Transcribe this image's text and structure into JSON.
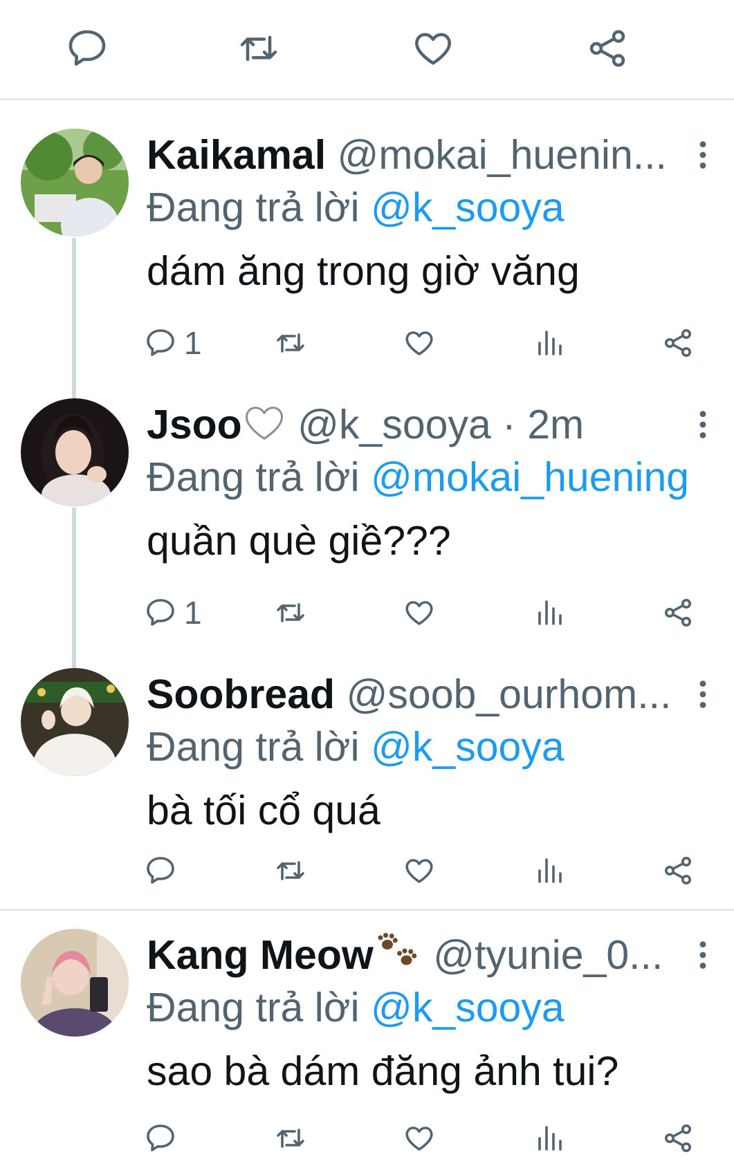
{
  "top_actions": {
    "reply_icon": "comment-icon",
    "retweet_icon": "retweet-icon",
    "like_icon": "heart-icon",
    "share_icon": "share-icon"
  },
  "colors": {
    "text": "#0f1419",
    "secondary": "#536471",
    "mention": "#1d9bf0",
    "divider": "#e6e9eb",
    "thread_line": "#cfd9de"
  },
  "replies": [
    {
      "name": "Kaikamal",
      "name_emoji": "",
      "handle": "@mokai_huenin...",
      "time": "",
      "replying_prefix": "Đang trả lời",
      "replying_to": "@k_sooya",
      "text": "dám ăng trong giờ văng",
      "reply_count": "1",
      "retweet_count": "",
      "like_count": ""
    },
    {
      "name": "Jsoo",
      "name_emoji": "🤍",
      "handle": "@k_sooya · 2m",
      "time": "",
      "replying_prefix": "Đang trả lời",
      "replying_to": "@mokai_huening",
      "text": "quần què giề???",
      "reply_count": "1",
      "retweet_count": "",
      "like_count": ""
    },
    {
      "name": "Soobread",
      "name_emoji": "",
      "handle": "@soob_ourhom...",
      "time": "",
      "replying_prefix": "Đang trả lời",
      "replying_to": "@k_sooya",
      "text": "bà tối cổ quá",
      "reply_count": "",
      "retweet_count": "",
      "like_count": ""
    },
    {
      "name": "Kang Meow",
      "name_emoji": "🐾",
      "handle": "@tyunie_0...",
      "time": "",
      "replying_prefix": "Đang trả lời",
      "replying_to": "@k_sooya",
      "text": "sao bà dám đăng ảnh tui?",
      "reply_count": "",
      "retweet_count": "",
      "like_count": ""
    }
  ]
}
